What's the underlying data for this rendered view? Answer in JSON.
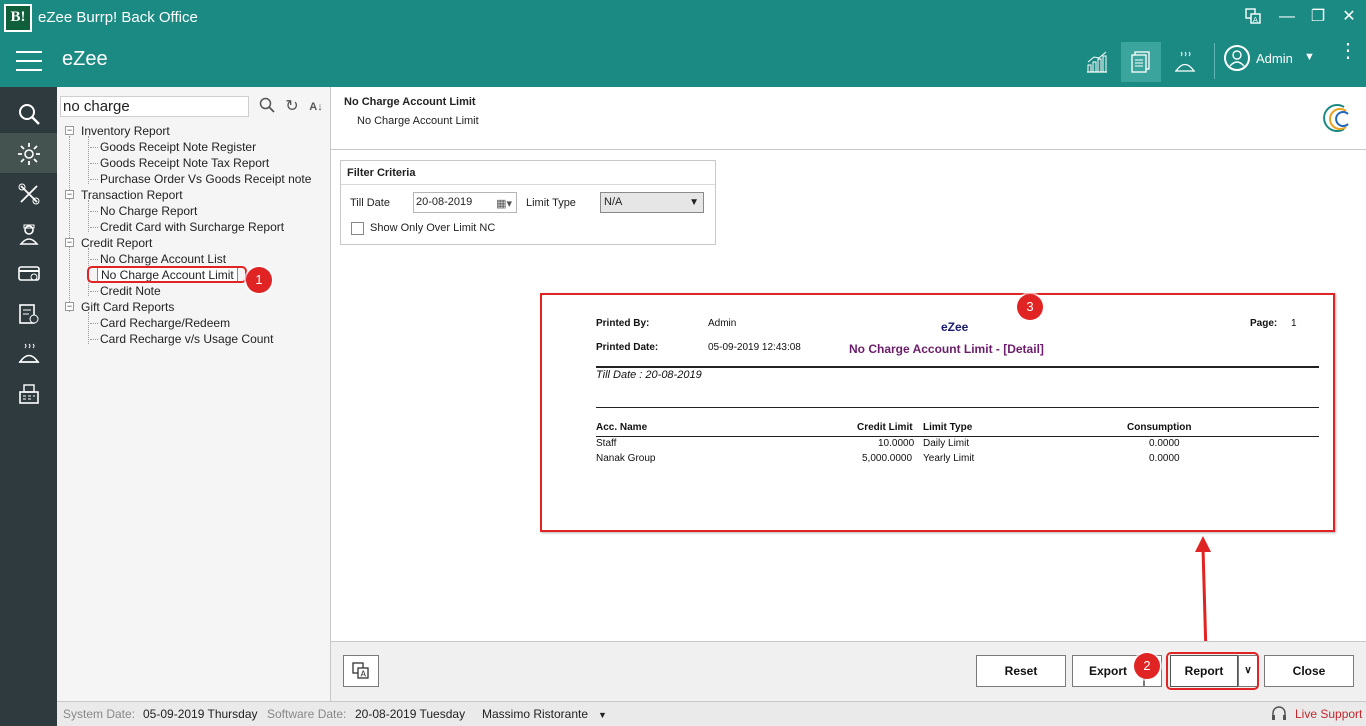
{
  "window": {
    "logo_text": "B!",
    "title": "eZee Burrp! Back Office"
  },
  "header": {
    "brand": "eZee",
    "user": "Admin"
  },
  "search": {
    "value": "no charge"
  },
  "tree": {
    "groups": [
      {
        "label": "Inventory Report",
        "items": [
          "Goods Receipt Note Register",
          "Goods Receipt Note Tax Report",
          "Purchase Order Vs Goods Receipt note"
        ]
      },
      {
        "label": "Transaction Report",
        "items": [
          "No Charge Report",
          "Credit Card with Surcharge Report"
        ]
      },
      {
        "label": "Credit Report",
        "items": [
          "No Charge Account List",
          "No Charge Account Limit",
          "Credit Note"
        ]
      },
      {
        "label": "Gift Card Reports",
        "items": [
          "Card Recharge/Redeem",
          "Card Recharge v/s Usage Count"
        ]
      }
    ]
  },
  "report_header": {
    "title": "No Charge Account Limit",
    "subtitle": "No Charge Account Limit"
  },
  "filter": {
    "title": "Filter Criteria",
    "till_date_label": "Till Date",
    "till_date_value": "20-08-2019",
    "limit_type_label": "Limit Type",
    "limit_type_value": "N/A",
    "checkbox_label": "Show Only Over Limit NC"
  },
  "preview": {
    "printed_by_label": "Printed By:",
    "printed_by_value": "Admin",
    "printed_date_label": "Printed Date:",
    "printed_date_value": "05-09-2019 12:43:08",
    "company": "eZee",
    "report_title": "No Charge Account Limit - [Detail]",
    "page_label": "Page:",
    "page_value": "1",
    "till_date_line": "Till Date : 20-08-2019",
    "columns": {
      "acc_name": "Acc. Name",
      "credit_limit": "Credit Limit",
      "limit_type": "Limit Type",
      "consumption": "Consumption"
    },
    "rows": [
      {
        "acc_name": "Staff",
        "credit_limit": "10.0000",
        "limit_type": "Daily Limit",
        "consumption": "0.0000"
      },
      {
        "acc_name": "Nanak Group",
        "credit_limit": "5,000.0000",
        "limit_type": "Yearly Limit",
        "consumption": "0.0000"
      }
    ]
  },
  "callouts": {
    "one": "1",
    "two": "2",
    "three": "3"
  },
  "buttons": {
    "reset": "Reset",
    "export": "Export",
    "report": "Report",
    "close": "Close"
  },
  "status": {
    "system_date_label": "System Date:",
    "system_date_value": "05-09-2019 Thursday",
    "software_date_label": "Software Date:",
    "software_date_value": "20-08-2019 Tuesday",
    "outlet": "Massimo Ristorante",
    "live_support": "Live Support"
  },
  "colors": {
    "header": "#1b8a83",
    "rail": "#2f3a3f",
    "callout": "#e02424"
  }
}
